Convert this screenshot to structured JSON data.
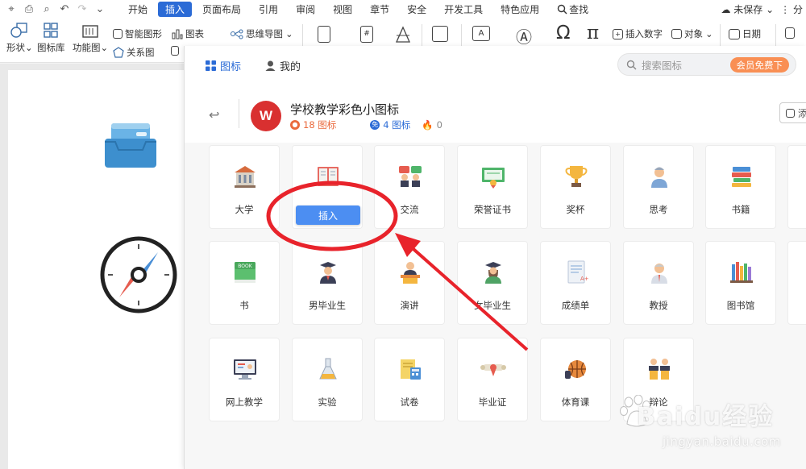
{
  "menubar": {
    "tabs": [
      "开始",
      "插入",
      "页面布局",
      "引用",
      "审阅",
      "视图",
      "章节",
      "安全",
      "开发工具",
      "特色应用"
    ],
    "active_tab": "插入",
    "search_label": "查找",
    "unsaved": "未保存",
    "share": "分"
  },
  "ribbon": {
    "shape": "形状",
    "icon_library": "图标库",
    "function_chart": "功能图",
    "smart_art": "智能图形",
    "chart": "图表",
    "mind_map": "思维导图",
    "relation_chart": "关系图",
    "insert_number": "插入数字",
    "object": "对象",
    "date": "日期"
  },
  "panel": {
    "tab_icons": "图标",
    "tab_mine": "我的",
    "search_placeholder": "搜索图标",
    "vip_free": "会员免费下",
    "set_title": "学校教学彩色小图标",
    "logo_text": "W",
    "stat_count": "18 图标",
    "stat_free": "4 图标",
    "stat_hot": "0",
    "side_btn": "添",
    "insert_button": "插入"
  },
  "icons": [
    {
      "label": "大学",
      "icon": "university-icon"
    },
    {
      "label": "",
      "icon": "book-open-icon"
    },
    {
      "label": "交流",
      "icon": "communication-icon"
    },
    {
      "label": "荣誉证书",
      "icon": "certificate-icon"
    },
    {
      "label": "奖杯",
      "icon": "trophy-icon"
    },
    {
      "label": "思考",
      "icon": "thinking-icon"
    },
    {
      "label": "书籍",
      "icon": "books-icon"
    },
    {
      "label": "书",
      "icon": "book-icon"
    },
    {
      "label": "男毕业生",
      "icon": "male-graduate-icon"
    },
    {
      "label": "演讲",
      "icon": "speech-icon"
    },
    {
      "label": "女毕业生",
      "icon": "female-graduate-icon"
    },
    {
      "label": "成绩单",
      "icon": "transcript-icon"
    },
    {
      "label": "教授",
      "icon": "professor-icon"
    },
    {
      "label": "图书馆",
      "icon": "library-icon"
    },
    {
      "label": "网上教学",
      "icon": "online-teaching-icon"
    },
    {
      "label": "实验",
      "icon": "experiment-icon"
    },
    {
      "label": "试卷",
      "icon": "exam-paper-icon"
    },
    {
      "label": "毕业证",
      "icon": "diploma-icon"
    },
    {
      "label": "体育课",
      "icon": "sports-class-icon"
    },
    {
      "label": "辩论",
      "icon": "debate-icon"
    }
  ],
  "watermark": {
    "brand": "Baidu经验",
    "url": "jingyan.baidu.com"
  },
  "colors": {
    "accent": "#2b6bd6",
    "vip": "#f98f54",
    "annotation": "#e8232b"
  }
}
